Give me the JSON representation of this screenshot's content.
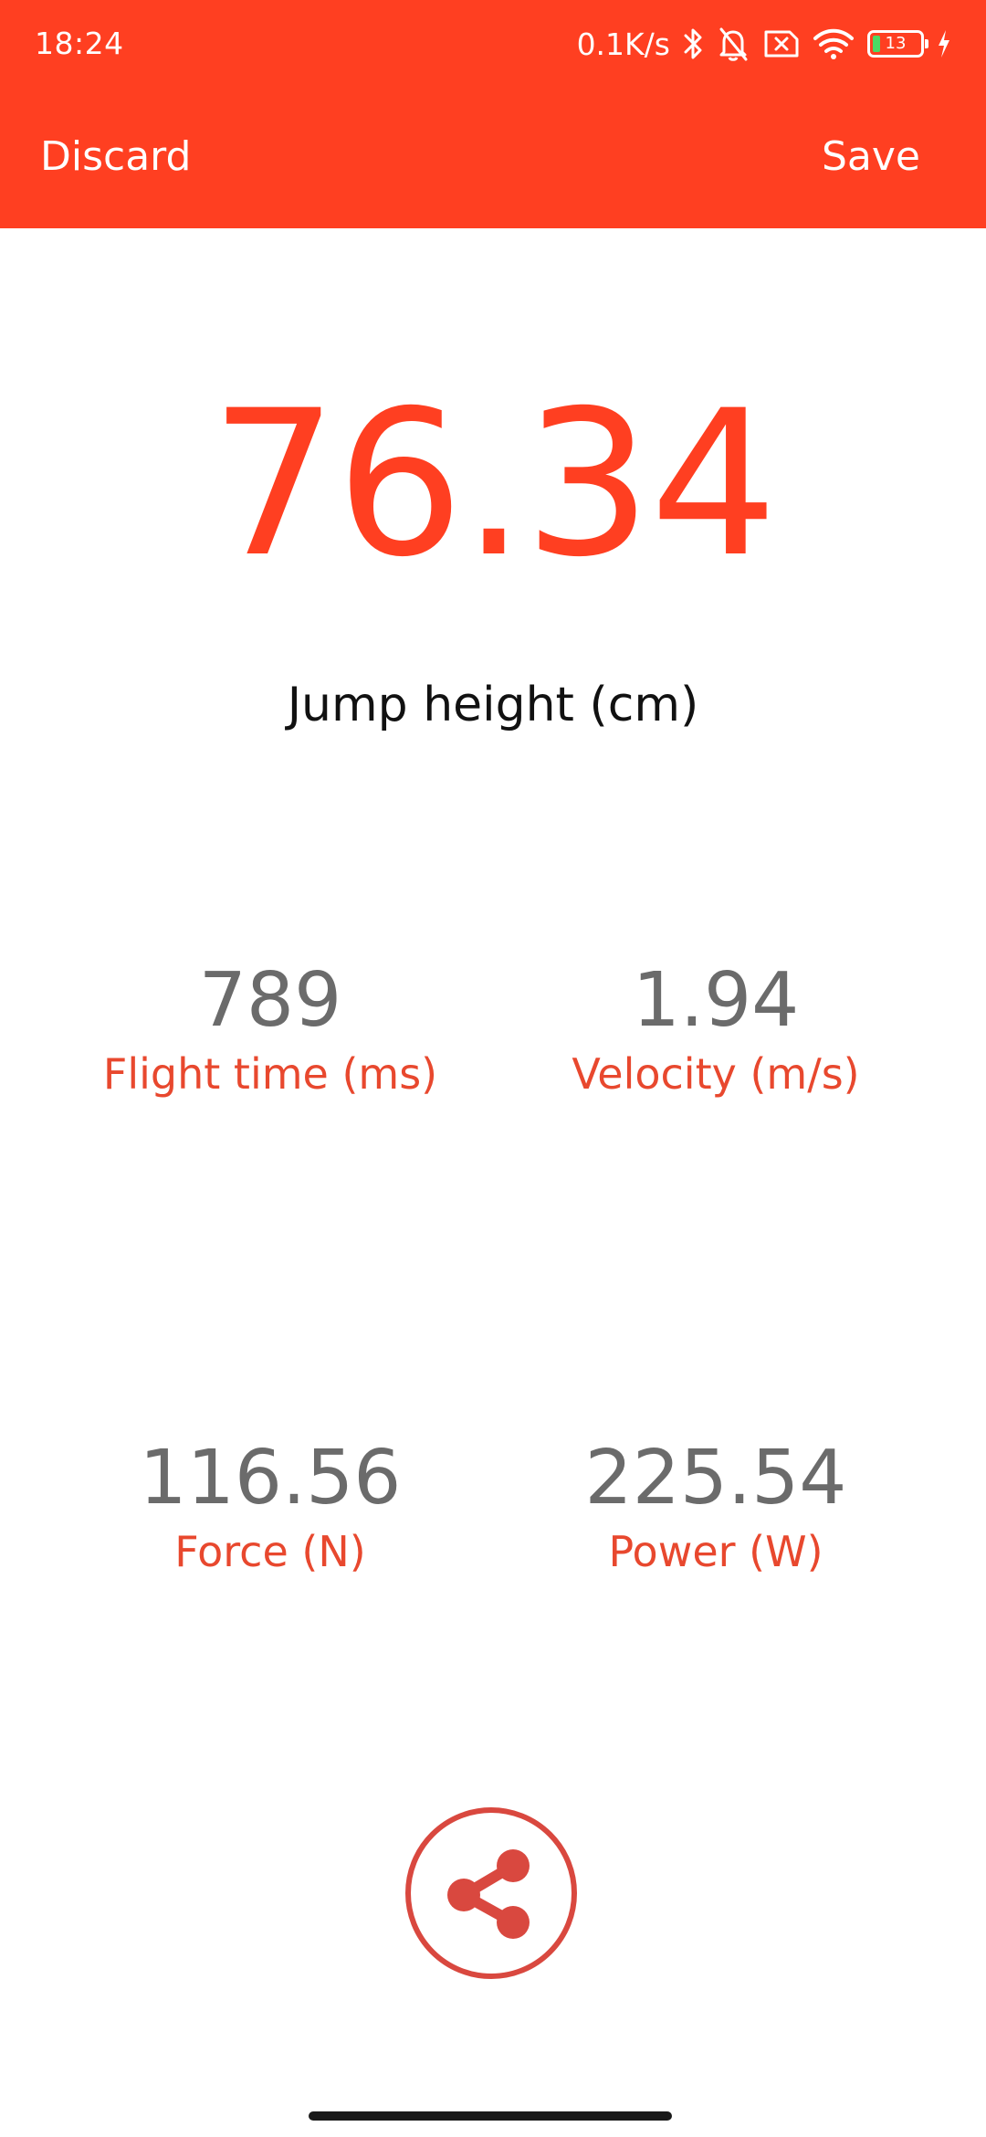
{
  "status_bar": {
    "time": "18:24",
    "net_speed": "0.1K/s",
    "battery_level": "13",
    "icons": [
      "bluetooth-icon",
      "bell-muted-icon",
      "sim-off-icon",
      "wifi-icon",
      "battery-icon",
      "charging-icon"
    ]
  },
  "toolbar": {
    "discard_label": "Discard",
    "save_label": "Save",
    "color": "#ff3f21"
  },
  "result": {
    "value": "76.34",
    "label": "Jump height (cm)",
    "color": "#ff3f21"
  },
  "metrics": [
    {
      "value": "789",
      "label": "Flight time (ms)"
    },
    {
      "value": "1.94",
      "label": "Velocity (m/s)"
    },
    {
      "value": "116.56",
      "label": "Force (N)"
    },
    {
      "value": "225.54",
      "label": "Power (W)"
    }
  ],
  "share": {
    "icon": "share-icon",
    "color": "#d9483f"
  }
}
